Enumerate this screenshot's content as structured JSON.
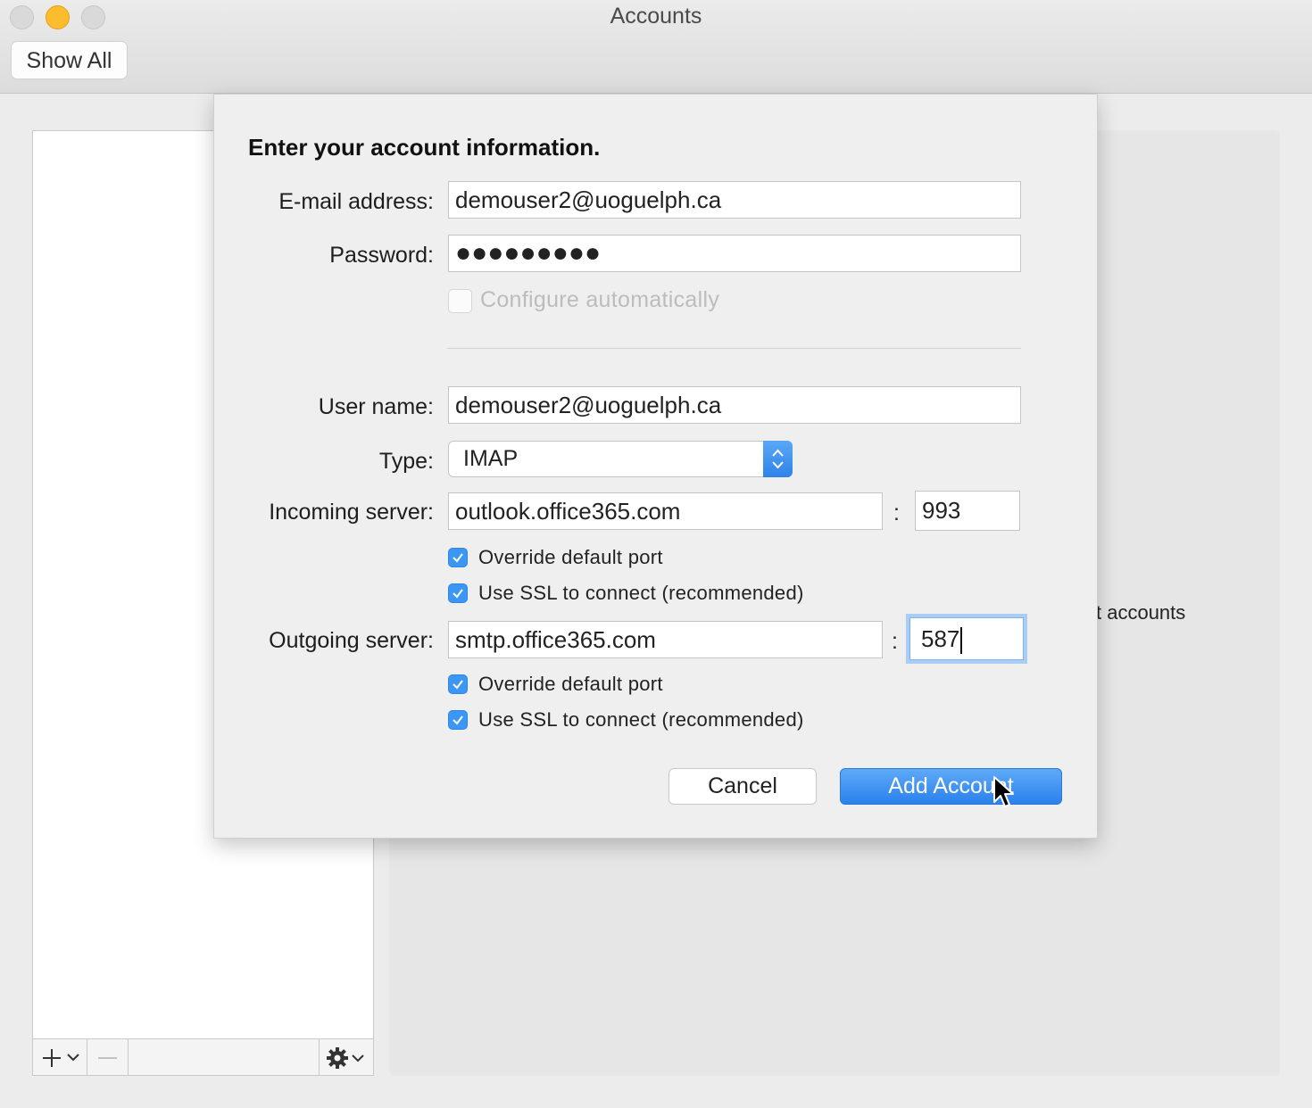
{
  "window": {
    "title": "Accounts",
    "show_all_label": "Show All"
  },
  "background": {
    "detail_text": "t accounts"
  },
  "sheet": {
    "heading": "Enter your account information.",
    "email": {
      "label": "E-mail address:",
      "value": "demouser2@uoguelph.ca"
    },
    "password": {
      "label": "Password:",
      "value": "●●●●●●●●●"
    },
    "configure_auto": {
      "label": "Configure automatically",
      "checked": false,
      "enabled": false
    },
    "username": {
      "label": "User name:",
      "value": "demouser2@uoguelph.ca"
    },
    "type": {
      "label": "Type:",
      "value": "IMAP"
    },
    "incoming": {
      "label": "Incoming server:",
      "server": "outlook.office365.com",
      "colon": ":",
      "port": "993",
      "override_label": "Override default port",
      "override_checked": true,
      "ssl_label": "Use SSL to connect (recommended)",
      "ssl_checked": true
    },
    "outgoing": {
      "label": "Outgoing server:",
      "server": "smtp.office365.com",
      "colon": ":",
      "port": "587",
      "override_label": "Override default port",
      "override_checked": true,
      "ssl_label": "Use SSL to connect (recommended)",
      "ssl_checked": true
    },
    "cancel_label": "Cancel",
    "add_label": "Add Account"
  },
  "icons": {
    "traffic_lights": [
      "close-icon",
      "minimize-icon",
      "zoom-icon"
    ],
    "list_toolbar": [
      "add-icon",
      "chevron-down-icon",
      "remove-icon",
      "gear-icon"
    ],
    "checkbox": "checkmark-icon",
    "select": "up-down-chevron-icon",
    "cursor": "mouse-pointer-icon"
  },
  "colors": {
    "accent": "#3c97f4",
    "focus_ring": "#a9cdf5",
    "minimize": "#fbbd2e"
  }
}
